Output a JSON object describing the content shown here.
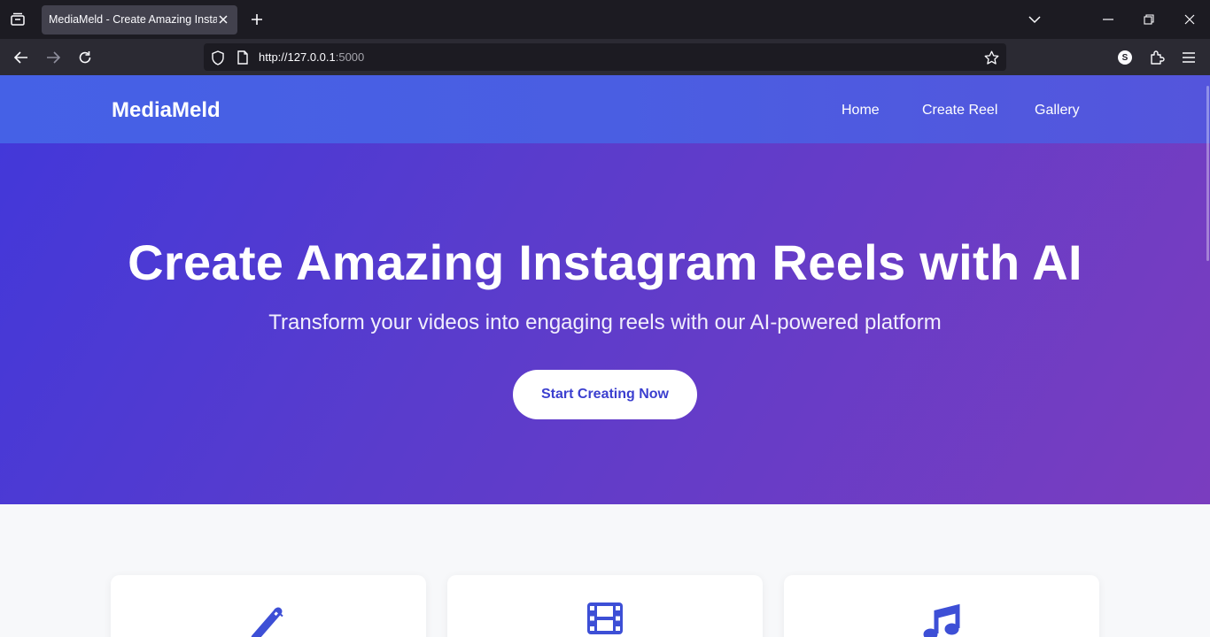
{
  "browser": {
    "tab_title": "MediaMeld - Create Amazing Instagram Reels with AI",
    "url_host": "http://127.0.0.1",
    "url_port": ":5000",
    "profile_initial": "S"
  },
  "site": {
    "brand": "MediaMeld",
    "nav": [
      "Home",
      "Create Reel",
      "Gallery"
    ]
  },
  "hero": {
    "title": "Create Amazing Instagram Reels with AI",
    "subtitle": "Transform your videos into engaging reels with our AI-powered platform",
    "cta": "Start Creating Now"
  },
  "features": [
    {
      "icon": "magic-wand-icon"
    },
    {
      "icon": "film-icon"
    },
    {
      "icon": "music-icon"
    }
  ],
  "colors": {
    "accent": "#4a5ee2",
    "hero_start": "#4338d9",
    "hero_end": "#7a3dbf",
    "cta_text": "#3b3fcf",
    "icon": "#3d4fd6"
  }
}
